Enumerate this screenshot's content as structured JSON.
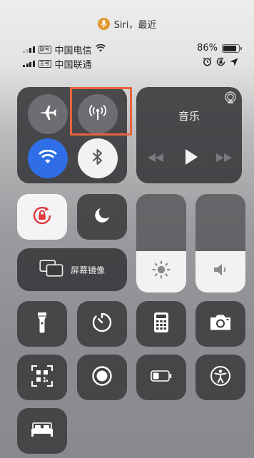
{
  "siri_suggestion": {
    "text": "Siri，最近",
    "icon": "microphone-icon",
    "color": "#e3962c"
  },
  "status_bar": {
    "carrier1": {
      "sim_label": "副号",
      "name": "中国电信",
      "icon": "wifi-icon"
    },
    "carrier2": {
      "sim_label": "主号",
      "name": "中国联通"
    },
    "battery_percent": "86%",
    "battery_level": 0.86,
    "status_icons": [
      "alarm-icon",
      "rotation-lock-icon",
      "location-icon"
    ]
  },
  "connectivity": {
    "airplane": {
      "icon": "airplane-icon",
      "active": false
    },
    "cellular": {
      "icon": "cellular-antenna-icon",
      "active": false
    },
    "wifi": {
      "icon": "wifi-icon",
      "active": true,
      "color": "#2f6ee6"
    },
    "bluetooth": {
      "icon": "bluetooth-icon",
      "active": true
    }
  },
  "music": {
    "title": "音乐",
    "icons": [
      "airplay-icon",
      "rewind-icon",
      "play-icon",
      "fast-forward-icon"
    ]
  },
  "controls": {
    "rotation_lock": {
      "icon": "rotation-lock-icon",
      "active": true,
      "color": "#e0393e"
    },
    "do_not_disturb": {
      "icon": "moon-icon",
      "active": false
    },
    "screen_mirroring": {
      "label": "屏幕镜像",
      "icon": "screen-mirroring-icon"
    },
    "brightness": {
      "icon": "sun-icon",
      "level": 0.42
    },
    "volume": {
      "icon": "speaker-icon",
      "level": 0.42
    }
  },
  "shortcuts": [
    {
      "name": "flashlight",
      "icon": "flashlight-icon"
    },
    {
      "name": "timer",
      "icon": "timer-icon"
    },
    {
      "name": "calculator",
      "icon": "calculator-icon"
    },
    {
      "name": "camera",
      "icon": "camera-icon"
    },
    {
      "name": "qr-scanner",
      "icon": "qr-code-icon"
    },
    {
      "name": "screen-recording",
      "icon": "record-icon"
    },
    {
      "name": "low-power-mode",
      "icon": "battery-icon"
    },
    {
      "name": "accessibility",
      "icon": "accessibility-icon"
    },
    {
      "name": "sleep",
      "icon": "bed-icon"
    }
  ],
  "highlight_color": "#e8633a"
}
